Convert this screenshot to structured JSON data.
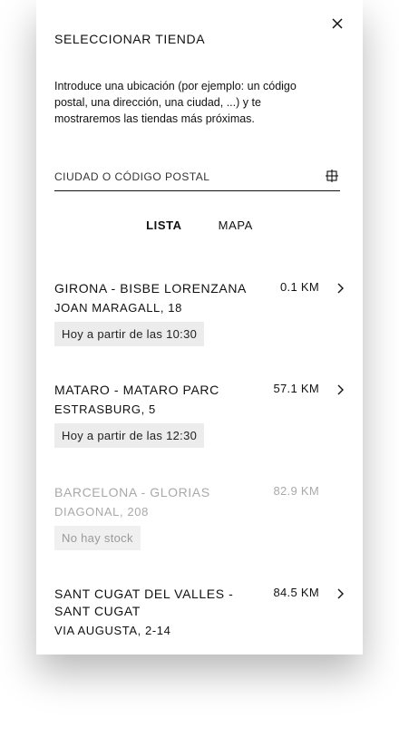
{
  "modal": {
    "title": "SELECCIONAR TIENDA",
    "description": "Introduce una ubicación (por ejemplo: un código postal, una dirección, una ciudad, ...) y te mostraremos las tiendas más próximas."
  },
  "search": {
    "placeholder": "CIUDAD O CÓDIGO POSTAL",
    "value": ""
  },
  "tabs": [
    {
      "label": "LISTA",
      "active": true
    },
    {
      "label": "MAPA",
      "active": false
    }
  ],
  "stores": [
    {
      "name": "GIRONA - BISBE LORENZANA",
      "address": "JOAN MARAGALL, 18",
      "distance": "0.1 KM",
      "availability": "Hoy a partir de las 10:30",
      "disabled": false
    },
    {
      "name": "MATARO - MATARO PARC",
      "address": "ESTRASBURG, 5",
      "distance": "57.1 KM",
      "availability": "Hoy a partir de las 12:30",
      "disabled": false
    },
    {
      "name": "BARCELONA - GLORIAS",
      "address": "DIAGONAL, 208",
      "distance": "82.9 KM",
      "availability": "No hay stock",
      "disabled": true
    },
    {
      "name": "SANT CUGAT DEL VALLES - SANT CUGAT",
      "address": "VIA AUGUSTA, 2-14",
      "distance": "84.5 KM",
      "availability": "",
      "disabled": false
    }
  ],
  "icons": {
    "close": "close-icon",
    "locate": "crosshair-icon",
    "chevron": "chevron-right-icon"
  }
}
